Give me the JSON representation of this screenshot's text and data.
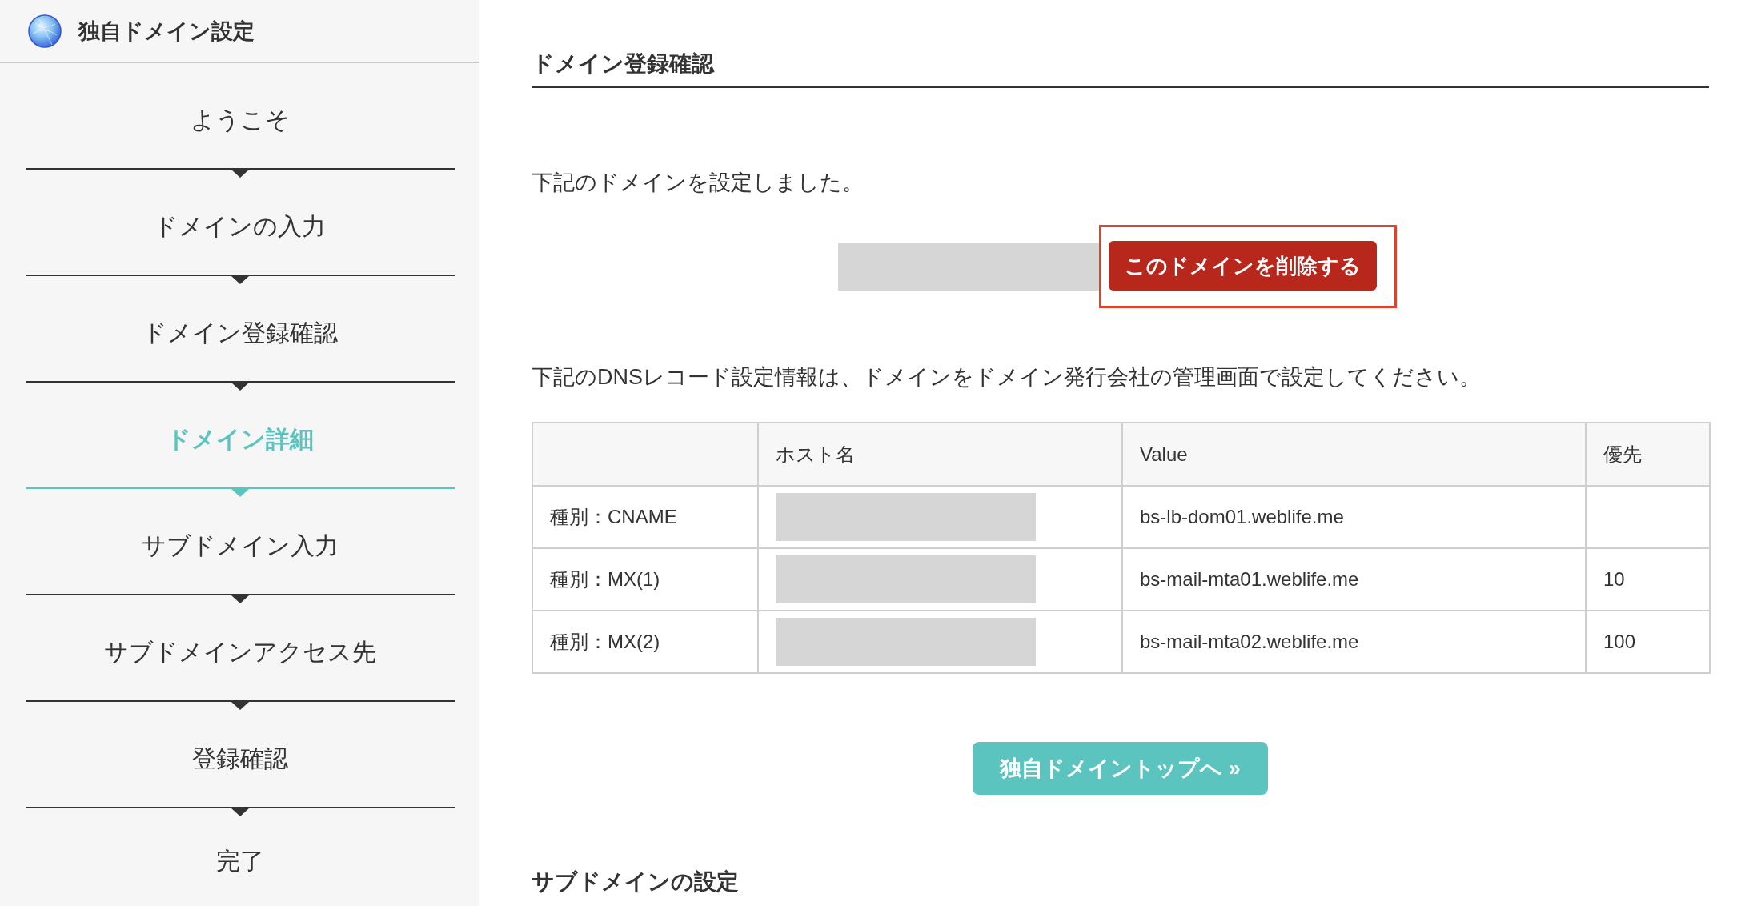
{
  "sidebar": {
    "title": "独自ドメイン設定",
    "steps": [
      {
        "label": "ようこそ",
        "selected": false
      },
      {
        "label": "ドメインの入力",
        "selected": false
      },
      {
        "label": "ドメイン登録確認",
        "selected": false
      },
      {
        "label": "ドメイン詳細",
        "selected": true
      },
      {
        "label": "サブドメイン入力",
        "selected": false
      },
      {
        "label": "サブドメインアクセス先",
        "selected": false
      },
      {
        "label": "登録確認",
        "selected": false
      },
      {
        "label": "完了",
        "selected": false
      }
    ]
  },
  "main": {
    "section_title": "ドメイン登録確認",
    "message": "下記のドメインを設定しました。",
    "domain": {
      "redacted": true
    },
    "delete_button": {
      "label": "このドメインを削除する",
      "highlighted": true
    },
    "dns_note": "下記のDNSレコード設定情報は、ドメインをドメイン発行会社の管理画面で設定してください。",
    "table": {
      "columns": [
        "ホスト名",
        "Value",
        "優先"
      ],
      "rows": [
        {
          "type": "種別：CNAME",
          "host": {
            "redacted": true
          },
          "value": "bs-lb-dom01.weblife.me"
        },
        {
          "type": "種別：MX(1)",
          "host": {
            "redacted": true
          },
          "value": "bs-mail-mta01.weblife.me",
          "priority": "10"
        },
        {
          "type": "種別：MX(2)",
          "host": {
            "redacted": true
          },
          "value": "bs-mail-mta02.weblife.me",
          "priority": "100"
        }
      ]
    },
    "back_button": {
      "label": "独自ドメイントップへ »"
    },
    "next_section_title": "サブドメインの設定"
  }
}
